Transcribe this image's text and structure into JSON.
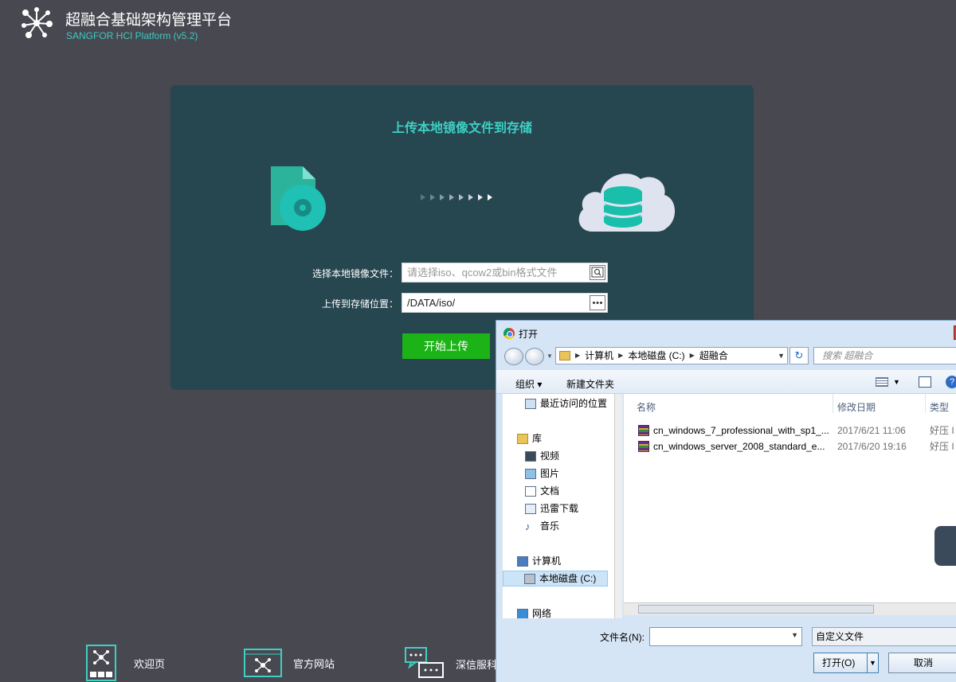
{
  "header": {
    "title": "超融合基础架构管理平台",
    "subtitle": "SANGFOR HCI Platform (v5.2)"
  },
  "upload": {
    "title": "上传本地镜像文件到存储",
    "file_label": "选择本地镜像文件：",
    "file_placeholder": "请选择iso、qcow2或bin格式文件",
    "storage_label": "上传到存储位置：",
    "storage_value": "/DATA/iso/",
    "start_label": "开始上传"
  },
  "bottom_nav": [
    {
      "label": "欢迎页"
    },
    {
      "label": "官方网站"
    },
    {
      "label": "深信服科"
    }
  ],
  "dialog": {
    "title": "打开",
    "breadcrumb": [
      "计算机",
      "本地磁盘 (C:)",
      "超融合"
    ],
    "search_placeholder": "搜索 超融合",
    "organize_label": "组织 ▾",
    "new_folder_label": "新建文件夹",
    "nav_items": [
      {
        "label": "最近访问的位置",
        "icon": "recent-places-icon"
      },
      {
        "label": "库",
        "icon": "library-icon"
      },
      {
        "label": "视频",
        "icon": "video-icon"
      },
      {
        "label": "图片",
        "icon": "pictures-icon"
      },
      {
        "label": "文档",
        "icon": "documents-icon"
      },
      {
        "label": "迅雷下载",
        "icon": "downloads-icon"
      },
      {
        "label": "音乐",
        "icon": "music-icon"
      },
      {
        "label": "计算机",
        "icon": "computer-icon"
      },
      {
        "label": "本地磁盘 (C:)",
        "icon": "drive-icon"
      },
      {
        "label": "网络",
        "icon": "network-icon"
      }
    ],
    "columns": [
      "名称",
      "修改日期",
      "类型"
    ],
    "files": [
      {
        "name": "cn_windows_7_professional_with_sp1_...",
        "date": "2017/6/21 11:06",
        "type": "好压 I"
      },
      {
        "name": "cn_windows_server_2008_standard_e...",
        "date": "2017/6/20 19:16",
        "type": "好压 I"
      }
    ],
    "filename_label": "文件名(N):",
    "filename_value": "",
    "filter_value": "自定义文件",
    "open_label": "打开(O)",
    "cancel_label": "取消"
  },
  "colors": {
    "background": "#484851",
    "panel": "#274750",
    "accent": "#3fcfc3",
    "start_button": "#1cb316"
  }
}
